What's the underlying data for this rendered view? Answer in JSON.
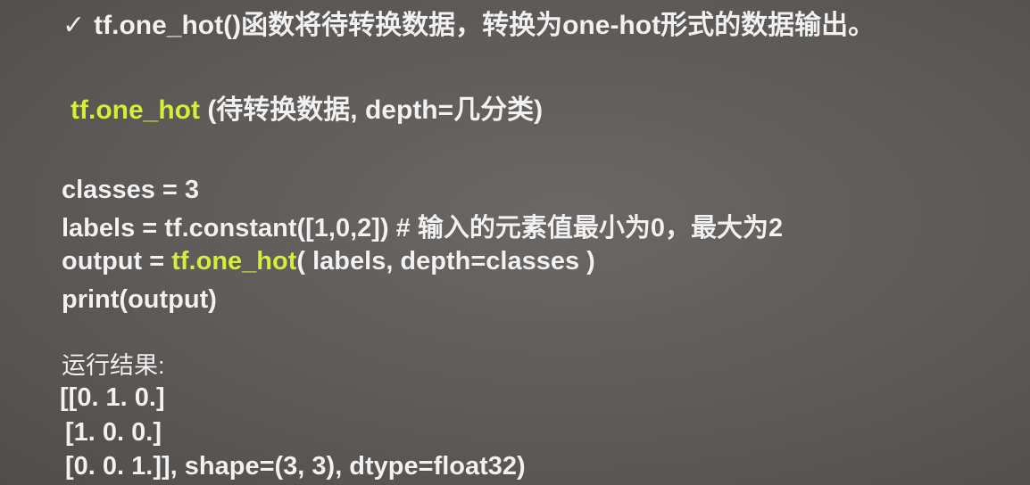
{
  "bullet": {
    "check": "✓",
    "func": "tf.one_hot()",
    "text_a": "函数将待转换数据，转换为",
    "term": "one-hot",
    "text_b": "形式的数据输出。"
  },
  "syntax": {
    "func": "tf.one_hot",
    "args": " (待转换数据, depth=几分类)"
  },
  "code": {
    "line1": "classes = 3",
    "line2": "labels = tf.constant([1,0,2])  # 输入的元素值最小为0，最大为2",
    "line3_pre": "output = ",
    "line3_func": "tf.one_hot",
    "line3_post": "( labels, depth=classes )",
    "line4": "print(output)"
  },
  "result": {
    "label": "运行结果:",
    "line1": "[[0. 1. 0.]",
    "line2": "[1. 0. 0.]",
    "line3": "[0. 0. 1.]], shape=(3, 3), dtype=float32)"
  },
  "colors": {
    "background": "#5e5a58",
    "text": "#f2f2f2",
    "highlight": "#d4ef3a"
  }
}
